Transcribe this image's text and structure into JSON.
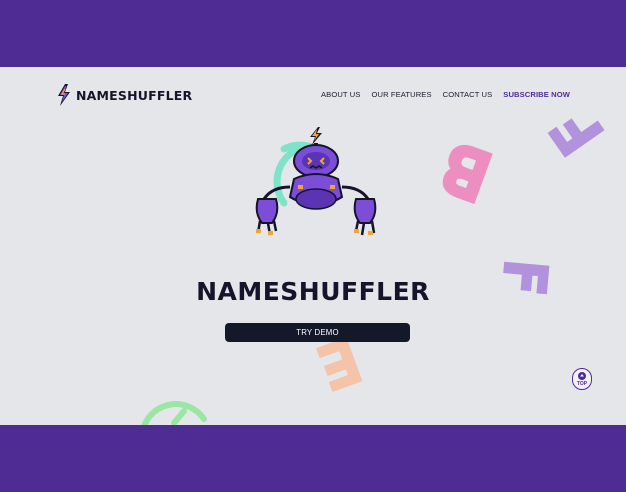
{
  "brand": {
    "name": "NAMESHUFFLER",
    "accent": "#4e2c94",
    "dark": "#15142a"
  },
  "nav": {
    "items": [
      {
        "label": "ABOUT US"
      },
      {
        "label": "OUR FEATURES"
      },
      {
        "label": "CONTACT US"
      },
      {
        "label": "SUBSCRIBE NOW"
      }
    ]
  },
  "hero": {
    "title": "NAMESHUFFLER",
    "cta_label": "TRY DEMO",
    "mascot_icon": "robot-mascot-icon"
  },
  "back_to_top": {
    "label": "TOP",
    "icon": "arrow-up-icon"
  },
  "decor": {
    "letters": [
      "B",
      "F",
      "F",
      "E"
    ],
    "colors": {
      "pink": "#ec8fc0",
      "lavender": "#b292dc",
      "peach": "#f4c3a8",
      "green": "#9ae6a3",
      "mint": "#7fe3c9"
    }
  }
}
